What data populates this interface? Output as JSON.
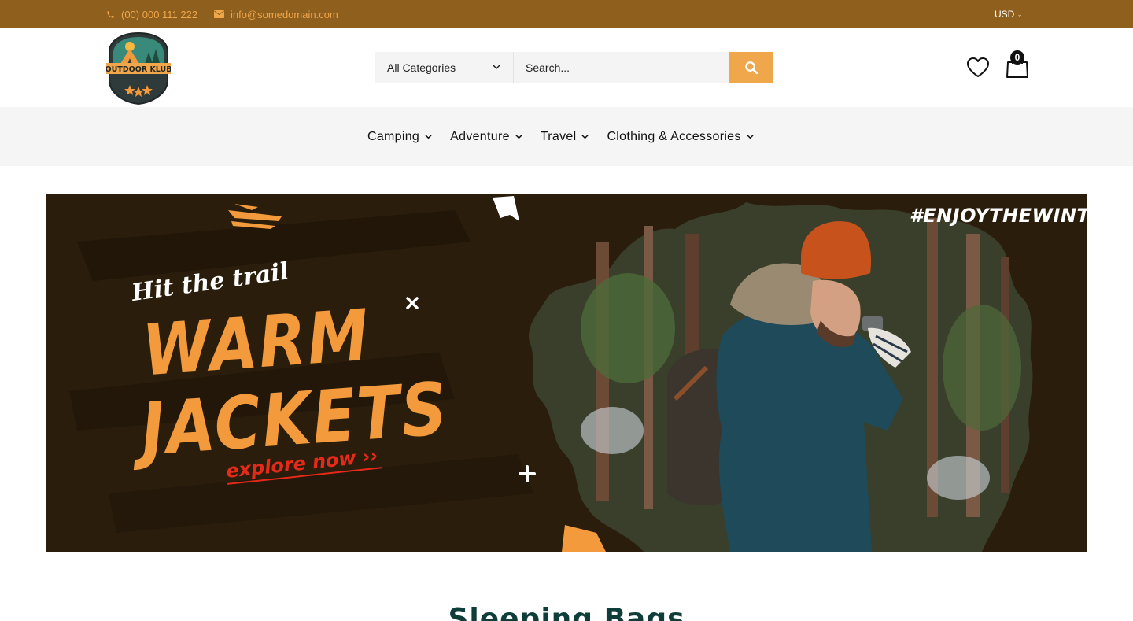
{
  "topbar": {
    "phone": "(00) 000 111 222",
    "email": "info@somedomain.com",
    "currency": "USD",
    "background": "#8e5f1d",
    "accent": "#f0a64a"
  },
  "header": {
    "logo_text": "OUTDOOR KLUB",
    "category_select": "All Categories",
    "search_placeholder": "Search...",
    "cart_count": "0",
    "icons": [
      "phone-icon",
      "mail-icon",
      "search-icon",
      "heart-icon",
      "shopping-bag-icon"
    ]
  },
  "nav": {
    "items": [
      {
        "label": "Camping"
      },
      {
        "label": "Adventure"
      },
      {
        "label": "Travel"
      },
      {
        "label": "Clothing & Accessories"
      }
    ]
  },
  "banner": {
    "line1": "Hit the trail",
    "line2": "WARM",
    "line3": "JACKETS",
    "cta": "explore now ››",
    "hashtag": "#ENJOYTHEWINTER",
    "accent": "#f39a3c",
    "cta_color": "#e52a1a"
  },
  "section": {
    "title": "Sleeping Bags"
  }
}
